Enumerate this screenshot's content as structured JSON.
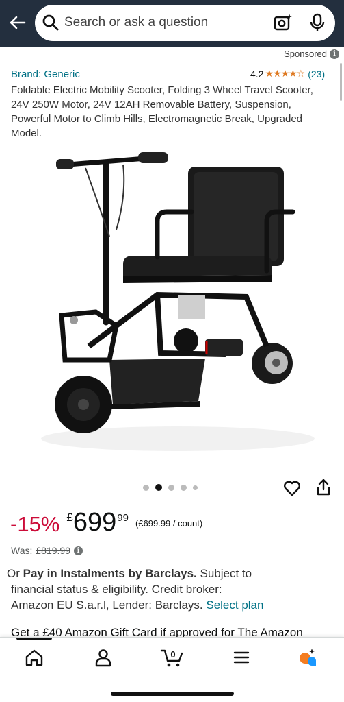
{
  "header": {
    "search_placeholder": "Search or ask a question",
    "icons": [
      "back-arrow-icon",
      "search-icon",
      "camera-icon",
      "microphone-icon"
    ]
  },
  "ad": {
    "label": "Sponsored",
    "info_glyph": "i"
  },
  "product": {
    "brand": "Brand: Generic",
    "rating": "4.2",
    "stars": "★★★★☆",
    "review_count": "(23)",
    "title": "Foldable Electric Mobility Scooter, Folding 3 Wheel Travel Scooter, 24V 250W Motor, 24V 12AH Removable Battery, Suspension, Powerful Motor to Climb Hills, Electromagnetic Break, Upgraded Model."
  },
  "gallery": {
    "image_count": 5,
    "active_index": 1
  },
  "price": {
    "discount": "-15%",
    "currency": "£",
    "whole": "699",
    "fraction": "99",
    "unit_price": "(£699.99 / count)",
    "was_label": "Was:",
    "was_price": "£819.99"
  },
  "instalments": {
    "prefix": "Or ",
    "bold": "Pay in Instalments by Barclays.",
    "line1_rest": " Subject to",
    "line2": "financial status & eligibility. Credit broker:",
    "line3": "Amazon EU S.a.r.l, Lender: Barclays. ",
    "link": "Select plan"
  },
  "promo": {
    "text": "Get a £40 Amazon Gift Card if approved for The Amazon"
  },
  "bottom_nav": {
    "cart_count": "0",
    "items": [
      "home-icon",
      "account-icon",
      "cart-icon",
      "menu-icon",
      "rufus-icon"
    ]
  },
  "colors": {
    "header_bg": "#232f3e",
    "link": "#007185",
    "discount": "#cc0c39",
    "star": "#de7921",
    "rufus_orange": "#f47d21",
    "rufus_blue": "#1a98ff"
  }
}
